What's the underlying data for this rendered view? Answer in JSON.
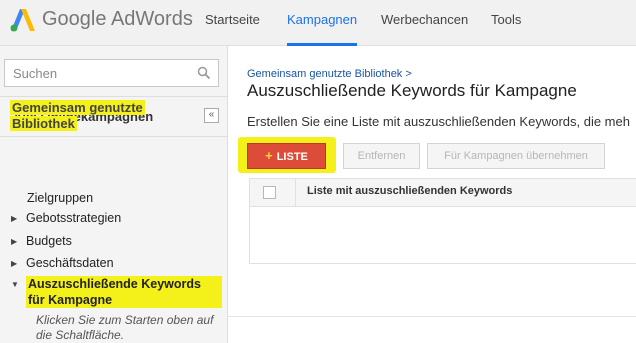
{
  "header": {
    "brand_google": "Google",
    "brand_product": "AdWords",
    "nav": [
      "Startseite",
      "Kampagnen",
      "Werbechancen",
      "Tools"
    ],
    "active_nav": "Kampagnen"
  },
  "sidebar": {
    "search_placeholder": "Suchen",
    "all_campaigns": "Alle Onlinekampagnen",
    "collapse_symbol": "«",
    "shared_library": "Gemeinsam genutzte Bibliothek",
    "items": [
      {
        "label": "Zielgruppen",
        "expandable": false
      },
      {
        "label": "Gebotsstrategien",
        "expandable": true
      },
      {
        "label": "Budgets",
        "expandable": true
      },
      {
        "label": "Geschäftsdaten",
        "expandable": true
      },
      {
        "label": "Auszuschließende Keywords für Kampagne",
        "expandable": true,
        "expanded": true,
        "selected": true
      }
    ],
    "hint": "Klicken Sie zum Starten oben auf die Schaltfläche."
  },
  "main": {
    "breadcrumb": "Gemeinsam genutzte Bibliothek >",
    "title": "Auszuschließende Keywords für Kampagne",
    "description": "Erstellen Sie eine Liste mit auszuschließenden Keywords, die meh",
    "buttons": {
      "add_plus": "+",
      "add_list": "LISTE",
      "remove": "Entfernen",
      "apply": "Für Kampagnen übernehmen"
    },
    "table": {
      "column_header": "Liste mit auszuschließenden Keywords"
    }
  },
  "colors": {
    "accent_blue": "#1a73e8",
    "highlight_yellow": "#f4f01a",
    "button_red": "#dd4b39"
  }
}
